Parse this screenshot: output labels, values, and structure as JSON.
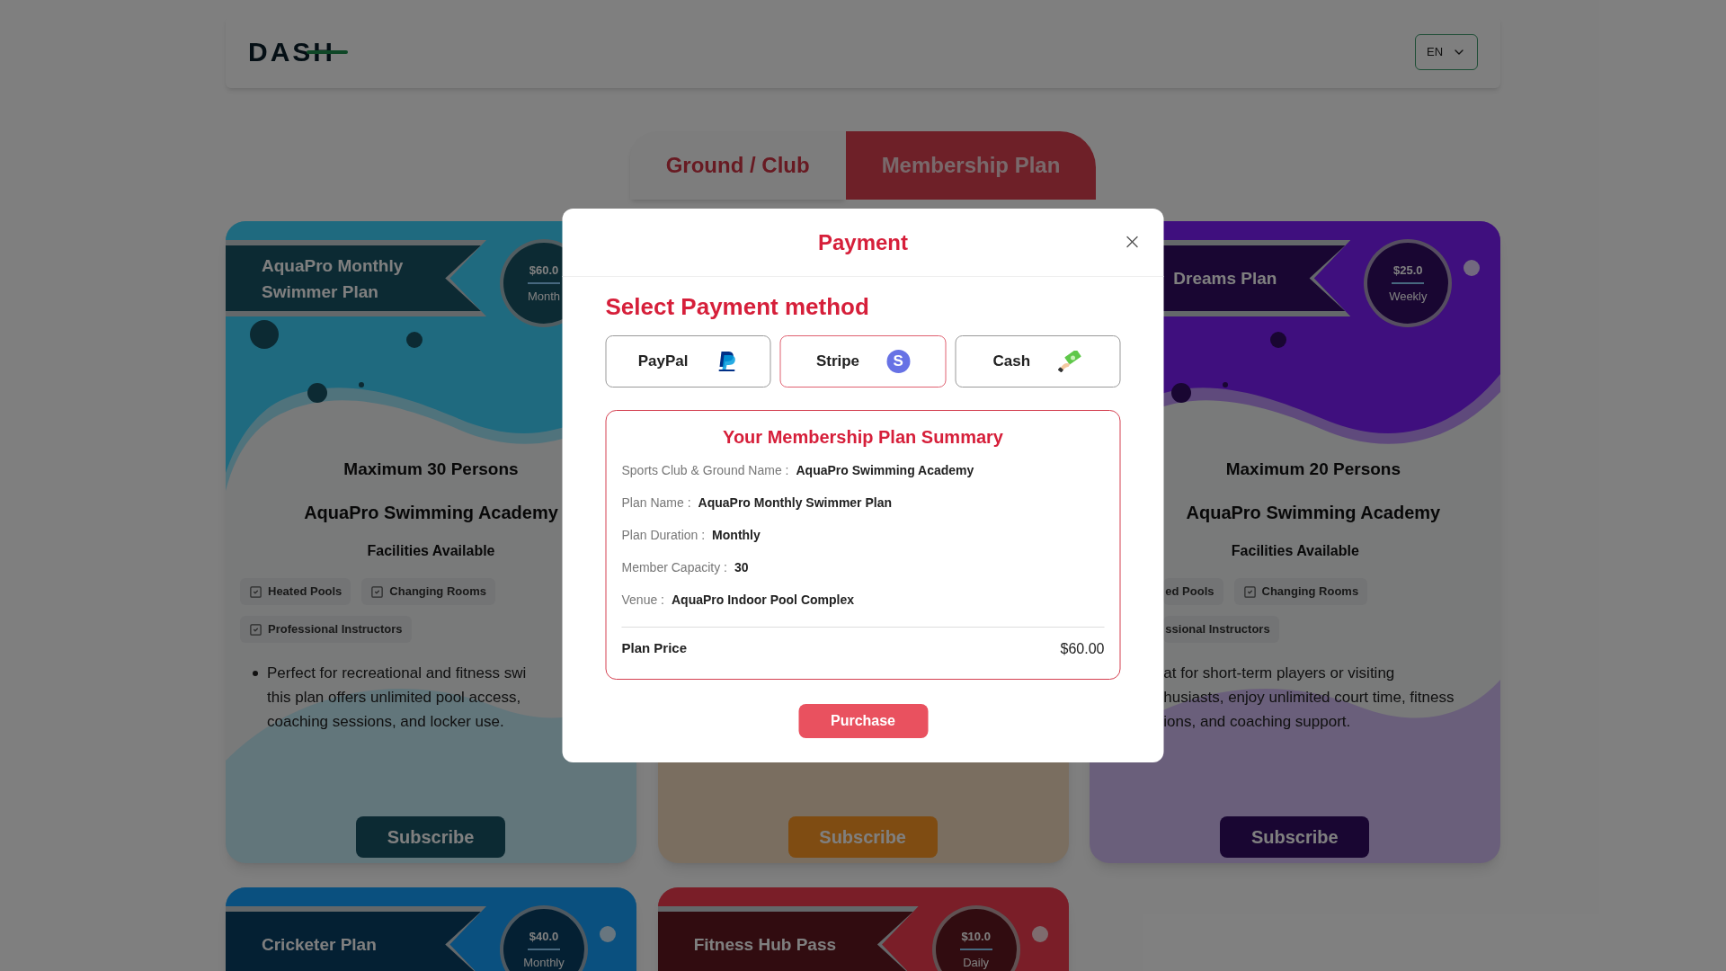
{
  "header": {
    "logo": "DASH",
    "language": "EN"
  },
  "tabs": [
    {
      "label": "Ground / Club",
      "selected": false
    },
    {
      "label": "Membership Plan",
      "selected": true
    }
  ],
  "cards": [
    {
      "title": "AquaPro Monthly Swimmer Plan",
      "price": "$60.0",
      "period": "Month",
      "color": "#1f6a80",
      "capacity": "Maximum 30 Persons",
      "club": "AquaPro Swimming Academy",
      "facilities_title": "Facilities Available",
      "facilities": [
        "Heated Pools",
        "Changing Rooms",
        "Professional Instructors"
      ],
      "description": [
        "Perfect for recreational and fitness swi",
        "this plan offers unlimited pool access,",
        "coaching sessions, and locker use."
      ],
      "subscribe": "Subscribe"
    },
    {
      "color": "#7f4c12",
      "subscribe": "Subscribe"
    },
    {
      "title": "Dreams Plan",
      "price": "$25.0",
      "period": "Weekly",
      "color": "#3f0f7e",
      "capacity": "Maximum 20 Persons",
      "club": "AquaPro Swimming Academy",
      "facilities_title": "Facilities Available",
      "facilities": [
        "ed Pools",
        "Changing Rooms",
        "ssional Instructors"
      ],
      "description": [
        "at for short-term players or visiting",
        "husiasts, enjoy unlimited court time, fitness",
        "ions, and coaching support."
      ],
      "subscribe": "Subscribe"
    },
    {
      "title": "Cricketer Plan",
      "price": "$40.0",
      "period": "Monthly",
      "color": "#0a507f"
    },
    {
      "title": "Fitness Hub Pass",
      "price": "$10.0",
      "period": "Daily",
      "color": "#7a1e28"
    }
  ],
  "modal": {
    "title": "Payment",
    "section_title": "Select Payment method",
    "methods": [
      {
        "kind": "paypal",
        "label": "PayPal",
        "selected": false
      },
      {
        "kind": "stripe",
        "label": "Stripe",
        "icon_text": "S",
        "selected": true
      },
      {
        "kind": "cash",
        "label": "Cash",
        "selected": false
      }
    ],
    "summary": {
      "title": "Your Membership Plan Summary",
      "rows": [
        {
          "label": "Sports Club & Ground Name :",
          "value": "AquaPro Swimming Academy"
        },
        {
          "label": "Plan Name :",
          "value": "AquaPro Monthly Swimmer Plan"
        },
        {
          "label": "Plan Duration :",
          "value": "Monthly"
        },
        {
          "label": "Member Capacity :",
          "value": "30"
        },
        {
          "label": "Venue :",
          "value": "AquaPro Indoor Pool Complex"
        }
      ],
      "price_label": "Plan Price",
      "price": "$60.00"
    },
    "button": "Purchase"
  }
}
